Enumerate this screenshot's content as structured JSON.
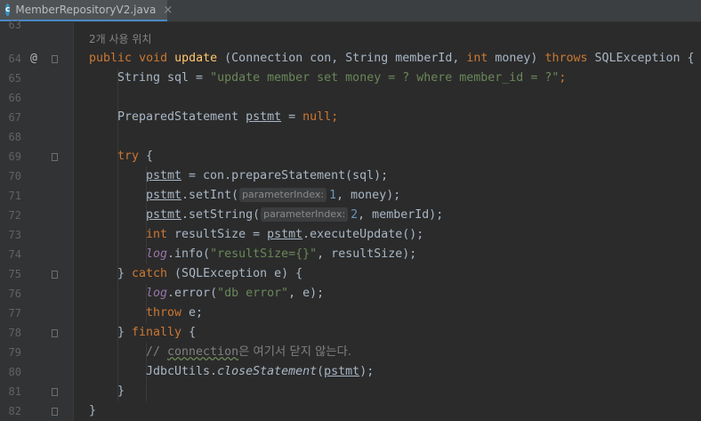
{
  "tab": {
    "file_name": "MemberRepositoryV2.java",
    "icon_letter": "c",
    "close": "×"
  },
  "usage_hint": "2개 사용 위치",
  "annotation": "@",
  "line_numbers": [
    "63",
    "64",
    "65",
    "66",
    "67",
    "68",
    "69",
    "70",
    "71",
    "72",
    "73",
    "74",
    "75",
    "76",
    "77",
    "78",
    "79",
    "80",
    "81",
    "82"
  ],
  "code": {
    "l64": {
      "kw1": "public",
      "kw2": "void",
      "method": "update",
      "p1": "(Connection con, String memberId, ",
      "kw3": "int",
      "p2": " money) ",
      "kw4": "throws",
      "p3": " SQLException {"
    },
    "l65": {
      "a": "String sql = ",
      "s": "\"update member set money = ? where member_id = ?\"",
      "b": ";"
    },
    "l67": {
      "a": "PreparedStatement ",
      "v": "pstmt",
      "b": " = ",
      "kw": "null",
      "c": ";"
    },
    "l69": {
      "kw": "try",
      "a": " {"
    },
    "l70": {
      "v": "pstmt",
      "a": " = con.prepareStatement(sql);"
    },
    "l71": {
      "v": "pstmt",
      "a": ".setInt(",
      "hint": "parameterIndex:",
      "n": "1",
      "b": ", money);"
    },
    "l72": {
      "v": "pstmt",
      "a": ".setString(",
      "hint": "parameterIndex:",
      "n": "2",
      "b": ", memberId);"
    },
    "l73": {
      "kw": "int",
      "a": " resultSize = ",
      "v": "pstmt",
      "b": ".executeUpdate();"
    },
    "l74": {
      "f": "log",
      "a": ".info(",
      "s": "\"resultSize={}\"",
      "b": ", resultSize);"
    },
    "l75": {
      "a": "} ",
      "kw": "catch",
      "b": " (SQLException e) {"
    },
    "l76": {
      "f": "log",
      "a": ".error(",
      "s": "\"db error\"",
      "b": ", e);"
    },
    "l77": {
      "kw": "throw",
      "a": " e;"
    },
    "l78": {
      "a": "} ",
      "kw": "finally",
      "b": " {"
    },
    "l79": {
      "c1": "// ",
      "c2": "connection",
      "c3": "은 여기서 닫지 않는다."
    },
    "l80": {
      "a": "JdbcUtils.",
      "m": "closeStatement",
      "b": "(",
      "v": "pstmt",
      "c": ");"
    },
    "l81": {
      "a": "}"
    },
    "l82": {
      "a": "}"
    }
  }
}
